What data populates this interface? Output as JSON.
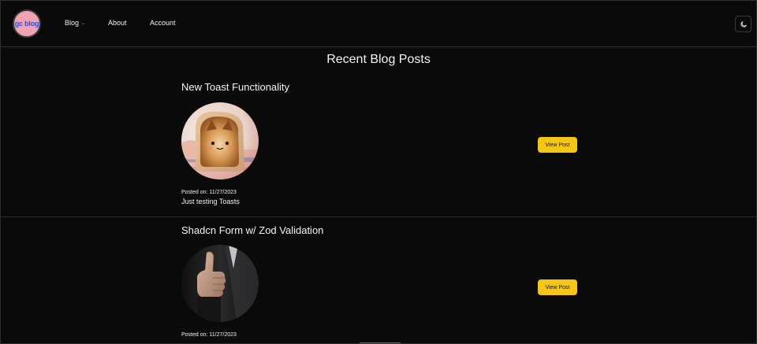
{
  "header": {
    "logo_text": "gc blog",
    "nav": {
      "blog": "Blog",
      "about": "About",
      "account": "Account"
    },
    "theme_toggle_icon": "moon-icon"
  },
  "main": {
    "title": "Recent Blog Posts",
    "posts": [
      {
        "title": "New Toast Functionality",
        "image": "toast-cat-image",
        "button": "View Post",
        "posted_on": "Posted on: 11/27/2023",
        "description": "Just testing Toasts"
      },
      {
        "title": "Shadcn Form w/ Zod Validation",
        "image": "thumbs-up-image",
        "button": "View Post",
        "posted_on": "Posted on: 11/27/2023"
      }
    ]
  },
  "colors": {
    "background": "#0b0a0a",
    "accent": "#f5c518",
    "logo_bg": "#f0a4b3",
    "logo_text": "#2f4fd9"
  }
}
